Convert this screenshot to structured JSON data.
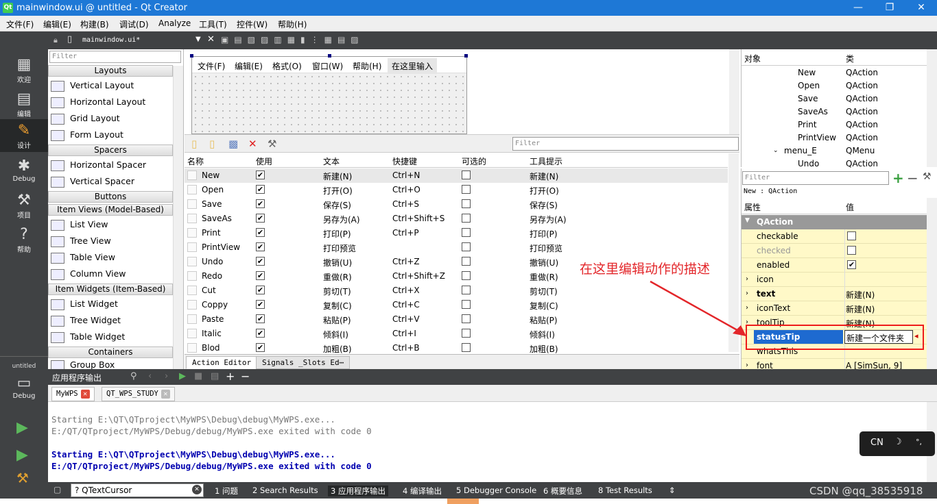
{
  "title_bar": {
    "app_icon_text": "Qt",
    "title": "mainwindow.ui @ untitled - Qt Creator",
    "minimize": "—",
    "maximize": "❐",
    "close": "✕"
  },
  "menu": [
    "文件(F)",
    "编辑(E)",
    "构建(B)",
    "调试(D)",
    "Analyze",
    "工具(T)",
    "控件(W)",
    "帮助(H)"
  ],
  "modes": [
    {
      "label": "欢迎",
      "icon": "grid-icon"
    },
    {
      "label": "编辑",
      "icon": "document-icon"
    },
    {
      "label": "设计",
      "icon": "pencil-icon"
    },
    {
      "label": "Debug",
      "icon": "bug-icon"
    },
    {
      "label": "项目",
      "icon": "wrench-icon"
    },
    {
      "label": "帮助",
      "icon": "help-icon"
    }
  ],
  "kit": {
    "project": "untitled",
    "label": "Debug"
  },
  "doc_bar": {
    "file": "mainwindow.ui*"
  },
  "widget_box": {
    "filter": "Filter",
    "categories": [
      "Layouts",
      "Spacers",
      "Buttons",
      "Item Views (Model-Based)",
      "Item Widgets (Item-Based)",
      "Containers"
    ],
    "layouts": [
      "Vertical Layout",
      "Horizontal Layout",
      "Grid Layout",
      "Form Layout"
    ],
    "spacers": [
      "Horizontal Spacer",
      "Vertical Spacer"
    ],
    "item_views": [
      "List View",
      "Tree View",
      "Table View",
      "Column View"
    ],
    "item_widgets": [
      "List Widget",
      "Tree Widget",
      "Table Widget"
    ],
    "containers": [
      "Group Box"
    ]
  },
  "form_menu": [
    "文件(F)",
    "编辑(E)",
    "格式(O)",
    "窗口(W)",
    "帮助(H)",
    "在这里输入"
  ],
  "action_editor": {
    "filter": "Filter",
    "headers": [
      "名称",
      "使用",
      "文本",
      "快捷键",
      "可选的",
      "工具提示"
    ],
    "rows": [
      {
        "name": "New",
        "used": true,
        "text": "新建(N)",
        "shortcut": "Ctrl+N",
        "checkable": false,
        "tooltip": "新建(N)"
      },
      {
        "name": "Open",
        "used": true,
        "text": "打开(O)",
        "shortcut": "Ctrl+O",
        "checkable": false,
        "tooltip": "打开(O)"
      },
      {
        "name": "Save",
        "used": true,
        "text": "保存(S)",
        "shortcut": "Ctrl+S",
        "checkable": false,
        "tooltip": "保存(S)"
      },
      {
        "name": "SaveAs",
        "used": true,
        "text": "另存为(A)",
        "shortcut": "Ctrl+Shift+S",
        "checkable": false,
        "tooltip": "另存为(A)"
      },
      {
        "name": "Print",
        "used": true,
        "text": "打印(P)",
        "shortcut": "Ctrl+P",
        "checkable": false,
        "tooltip": "打印(P)"
      },
      {
        "name": "PrintView",
        "used": true,
        "text": "打印预览",
        "shortcut": "",
        "checkable": false,
        "tooltip": "打印预览"
      },
      {
        "name": "Undo",
        "used": true,
        "text": "撤销(U)",
        "shortcut": "Ctrl+Z",
        "checkable": false,
        "tooltip": "撤销(U)"
      },
      {
        "name": "Redo",
        "used": true,
        "text": "重做(R)",
        "shortcut": "Ctrl+Shift+Z",
        "checkable": false,
        "tooltip": "重做(R)"
      },
      {
        "name": "Cut",
        "used": true,
        "text": "剪切(T)",
        "shortcut": "Ctrl+X",
        "checkable": false,
        "tooltip": "剪切(T)"
      },
      {
        "name": "Coppy",
        "used": true,
        "text": "复制(C)",
        "shortcut": "Ctrl+C",
        "checkable": false,
        "tooltip": "复制(C)"
      },
      {
        "name": "Paste",
        "used": true,
        "text": "粘贴(P)",
        "shortcut": "Ctrl+V",
        "checkable": false,
        "tooltip": "粘贴(P)"
      },
      {
        "name": "Italic",
        "used": true,
        "text": "倾斜(I)",
        "shortcut": "Ctrl+I",
        "checkable": false,
        "tooltip": "倾斜(I)"
      },
      {
        "name": "Blod",
        "used": true,
        "text": "加粗(B)",
        "shortcut": "Ctrl+B",
        "checkable": false,
        "tooltip": "加粗(B)"
      }
    ],
    "tabs": [
      "Action Editor",
      "Signals _Slots Ed⋯"
    ]
  },
  "object_inspector": {
    "headers": [
      "对象",
      "类"
    ],
    "rows": [
      {
        "name": "New",
        "cls": "QAction"
      },
      {
        "name": "Open",
        "cls": "QAction"
      },
      {
        "name": "Save",
        "cls": "QAction"
      },
      {
        "name": "SaveAs",
        "cls": "QAction"
      },
      {
        "name": "Print",
        "cls": "QAction"
      },
      {
        "name": "PrintView",
        "cls": "QAction"
      },
      {
        "name": "menu_E",
        "cls": "QMenu"
      },
      {
        "name": "Undo",
        "cls": "QAction"
      }
    ]
  },
  "property_editor": {
    "filter": "Filter",
    "object_line": "New : QAction",
    "headers": [
      "属性",
      "值"
    ],
    "category": "QAction",
    "rows": [
      {
        "name": "checkable",
        "value": "",
        "bold": false,
        "dim": false,
        "check": "unchecked"
      },
      {
        "name": "checked",
        "value": "",
        "bold": false,
        "dim": true,
        "check": "unchecked"
      },
      {
        "name": "enabled",
        "value": "",
        "bold": false,
        "dim": false,
        "check": "checked"
      },
      {
        "name": "icon",
        "value": "",
        "bold": false,
        "dim": false,
        "check": "none"
      },
      {
        "name": "text",
        "value": "新建(N)",
        "bold": true,
        "dim": false,
        "check": "none"
      },
      {
        "name": "iconText",
        "value": "新建(N)",
        "bold": false,
        "dim": false,
        "check": "none"
      },
      {
        "name": "toolTip",
        "value": "新建(N)",
        "bold": false,
        "dim": false,
        "check": "none"
      },
      {
        "name": "statusTip",
        "value": "新建一个文件夹",
        "bold": true,
        "dim": false,
        "check": "none"
      },
      {
        "name": "whatsThis",
        "value": "",
        "bold": false,
        "dim": false,
        "check": "none"
      },
      {
        "name": "font",
        "value": "A  [SimSun, 9]",
        "bold": false,
        "dim": false,
        "check": "none"
      }
    ]
  },
  "output": {
    "title": "应用程序输出",
    "tabs": [
      "MyWPS",
      "QT_WPS_STUDY"
    ],
    "lines": [
      {
        "text": "Starting E:\\QT\\QTproject\\MyWPS\\Debug\\debug\\MyWPS.exe...",
        "style": "grey"
      },
      {
        "text": "E:/QT/QTproject/MyWPS/Debug/debug/MyWPS.exe exited with code 0",
        "style": "grey"
      },
      {
        "text": "Starting E:\\QT\\QTproject\\MyWPS\\Debug\\debug\\MyWPS.exe...",
        "style": "blue"
      },
      {
        "text": "E:/QT/QTproject/MyWPS/Debug/debug/MyWPS.exe exited with code 0",
        "style": "blue"
      }
    ]
  },
  "status_bar": {
    "search": "? QTextCursor",
    "items": [
      "1 问题",
      "2 Search Results",
      "3 应用程序输出",
      "4 编译输出",
      "5 Debugger Console",
      "6 概要信息",
      "8 Test Results"
    ]
  },
  "annotation": "在这里编辑动作的描述",
  "ime": {
    "lang": "CN",
    "moon": "☽",
    "punct": "°,"
  },
  "watermark": "CSDN @qq_38535918",
  "colors": {
    "accent": "#1e78d6",
    "annotation_red": "#e3262a",
    "property_row": "#fff9c8",
    "mode_bar": "#404244"
  }
}
